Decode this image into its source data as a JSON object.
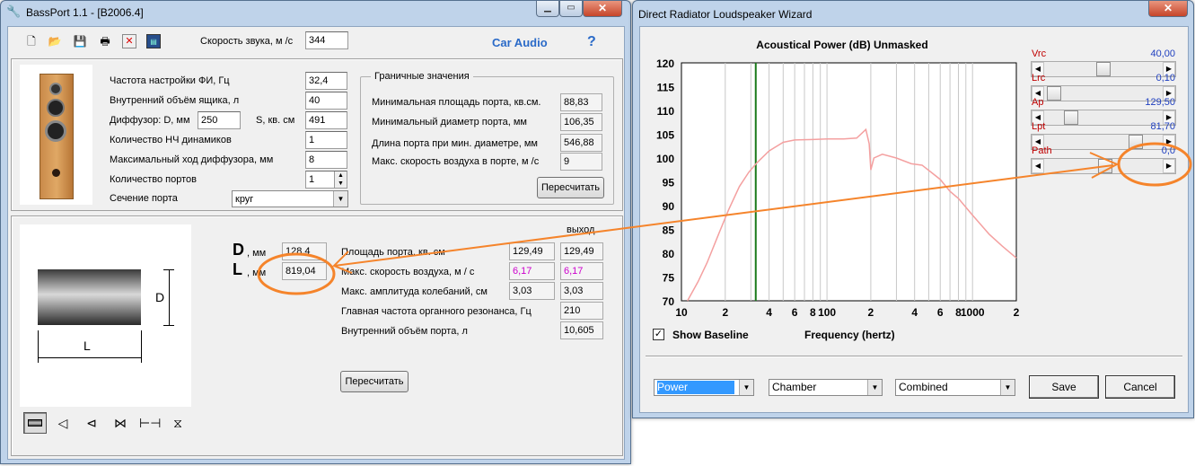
{
  "left_window": {
    "title": "BassPort 1.1 - [B2006.4]",
    "toolbar_icons": [
      "new-document-icon",
      "open-folder-icon",
      "save-disk-icon",
      "print-icon",
      "delete-icon",
      "calculator-icon"
    ],
    "sound_speed_label": "Скорость звука, м /с",
    "sound_speed_value": "344",
    "car_audio": "Car Audio",
    "help": "?",
    "params": {
      "tuning_label": "Частота настройки ФИ, Гц",
      "tuning_value": "32,4",
      "volume_label": "Внутренний объём ящика, л",
      "volume_value": "40",
      "diffuser_label": "Диффузор: D, мм",
      "diffuser_d_value": "250",
      "s_label": "S, кв. см",
      "s_value": "491",
      "drivers_label": "Количество НЧ динамиков",
      "drivers_value": "1",
      "xmax_label": "Максимальный ход диффузора, мм",
      "xmax_value": "8",
      "ports_label": "Количество портов",
      "ports_value": "1",
      "section_label": "Сечение порта",
      "section_value": "круг"
    },
    "limits": {
      "group_title": "Граничные значения",
      "min_area_label": "Минимальная площадь порта, кв.см.",
      "min_area_value": "88,83",
      "min_diam_label": "Минимальный диаметр порта, мм",
      "min_diam_value": "106,35",
      "len_label": "Длина порта при мин. диаметре, мм",
      "len_value": "546,88",
      "airspeed_label": "Макс. скорость воздуха в порте, м /с",
      "airspeed_value": "9",
      "recalc": "Пересчитать"
    },
    "port": {
      "d_big": "D",
      "d_unit": ", мм",
      "d_value": "128,4",
      "l_big": "L",
      "l_unit": ", мм",
      "l_value": "819,04",
      "exit_header": "выход",
      "diagram_d": "D",
      "diagram_l": "L",
      "rows": [
        {
          "label": "Площадь порта, кв. см",
          "v1": "129,49",
          "v2": "129,49"
        },
        {
          "label": "Макс. скорость воздуха, м / с",
          "v1": "6,17",
          "v2": "6,17"
        },
        {
          "label": "Макс. амплитуда колебаний, см",
          "v1": "3,03",
          "v2": "3,03"
        },
        {
          "label": "Главная частота органного резонанса, Гц",
          "v2": "210"
        },
        {
          "label": "Внутренний объём порта, л",
          "v2": "10,605"
        }
      ],
      "recalc": "Пересчитать",
      "highlight_color": "#cc00cc"
    },
    "port_shapes": [
      "straight-port-icon",
      "flared-port-icon",
      "horn-port-icon",
      "double-flared-port-icon",
      "bracket-port-icon",
      "hourglass-port-icon"
    ]
  },
  "right_window": {
    "title": "Direct Radiator Loudspeaker Wizard",
    "chart_title": "Acoustical Power (dB)   Unmasked",
    "show_baseline_label": "Show Baseline",
    "show_baseline_checked": true,
    "freq_label": "Frequency (hertz)",
    "sliders": [
      {
        "label": "Vrc",
        "value": "40,00",
        "pos": 0.5
      },
      {
        "label": "Lrc",
        "value": "0,10",
        "pos": 0.02
      },
      {
        "label": "Ap",
        "value": "129,50",
        "pos": 0.18
      },
      {
        "label": "Lpt",
        "value": "81,70",
        "pos": 0.82
      },
      {
        "label": "Path",
        "value": "0,0",
        "pos": 0.52
      }
    ],
    "combos": [
      "Power",
      "Chamber",
      "Combined"
    ],
    "save": "Save",
    "cancel": "Cancel"
  },
  "chart_data": {
    "type": "line",
    "title": "Acoustical Power (dB)   Unmasked",
    "xlabel": "Frequency (hertz)",
    "ylabel": "",
    "xscale": "log",
    "xlim": [
      10,
      2000
    ],
    "ylim": [
      70,
      120
    ],
    "ytick_labels": [
      "120",
      "115",
      "110",
      "105",
      "100",
      "95",
      "90",
      "85",
      "80",
      "75",
      "70"
    ],
    "xtick_labels": [
      "10",
      "2",
      "4",
      "6",
      "8",
      "100",
      "2",
      "4",
      "6",
      "8",
      "1000",
      "2"
    ],
    "marker_x": 32.4,
    "marker_color": "#1a7a1a",
    "line_color": "#f4a0a0",
    "grid": true,
    "series": [
      {
        "x": [
          11,
          13,
          15,
          18,
          21,
          25,
          29,
          33,
          40,
          50,
          60,
          80,
          100,
          130,
          160,
          185,
          195,
          200,
          210,
          240,
          300,
          380,
          450,
          520,
          600,
          700,
          800,
          1000,
          1300,
          1600,
          2000
        ],
        "y": [
          70,
          74,
          78,
          84,
          89,
          94,
          97,
          99,
          101.5,
          103.3,
          103.8,
          103.9,
          104,
          104,
          104.2,
          106,
          103,
          97.5,
          100,
          100.8,
          100,
          98.8,
          98.5,
          97,
          95.5,
          93,
          91.5,
          88,
          84,
          81.5,
          79
        ]
      }
    ]
  }
}
